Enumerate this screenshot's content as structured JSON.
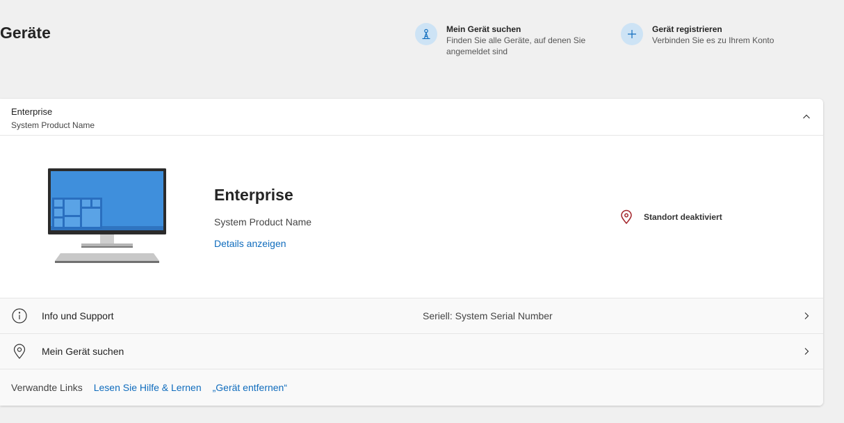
{
  "page": {
    "title": "Geräte"
  },
  "quick_actions": {
    "find": {
      "title": "Mein Gerät suchen",
      "description_line1": "Finden Sie alle Geräte, auf denen Sie",
      "description_line2": "angemeldet sind",
      "icon": "person-location-icon"
    },
    "register": {
      "title": "Gerät registrieren",
      "description": "Verbinden Sie es zu Ihrem Konto",
      "icon": "plus-icon"
    }
  },
  "device_card": {
    "header": {
      "name": "Enterprise",
      "model": "System Product Name",
      "expanded": true
    },
    "body": {
      "name": "Enterprise",
      "model": "System Product Name",
      "details_link": "Details anzeigen",
      "location_status": "Standort deaktiviert"
    },
    "rows": [
      {
        "label": "Info und Support",
        "meta": "Seriell: System Serial Number",
        "icon": "info-icon"
      },
      {
        "label": "Mein Gerät suchen",
        "meta": "",
        "icon": "location-pin-icon"
      }
    ],
    "related_links": {
      "label": "Verwandte Links",
      "links": [
        "Lesen Sie Hilfe & Lernen",
        "„Gerät entfernen“"
      ]
    }
  },
  "colors": {
    "background": "#f0f0f0",
    "card": "#ffffff",
    "link": "#0f6cbd",
    "icon_circle": "#cde3f5",
    "location_warning": "#a4262c",
    "screen_blue": "#3f8fdc"
  }
}
